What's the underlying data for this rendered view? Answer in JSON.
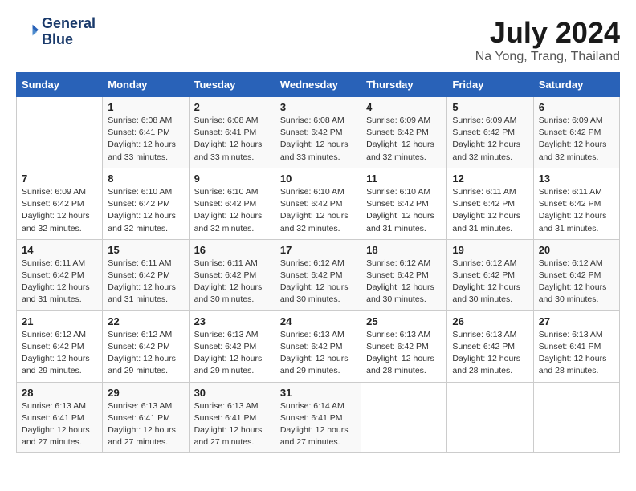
{
  "header": {
    "logo_line1": "General",
    "logo_line2": "Blue",
    "title": "July 2024",
    "subtitle": "Na Yong, Trang, Thailand"
  },
  "calendar": {
    "days_of_week": [
      "Sunday",
      "Monday",
      "Tuesday",
      "Wednesday",
      "Thursday",
      "Friday",
      "Saturday"
    ],
    "weeks": [
      [
        {
          "day": "",
          "sunrise": "",
          "sunset": "",
          "daylight": ""
        },
        {
          "day": "1",
          "sunrise": "6:08 AM",
          "sunset": "6:41 PM",
          "daylight": "12 hours and 33 minutes."
        },
        {
          "day": "2",
          "sunrise": "6:08 AM",
          "sunset": "6:41 PM",
          "daylight": "12 hours and 33 minutes."
        },
        {
          "day": "3",
          "sunrise": "6:08 AM",
          "sunset": "6:42 PM",
          "daylight": "12 hours and 33 minutes."
        },
        {
          "day": "4",
          "sunrise": "6:09 AM",
          "sunset": "6:42 PM",
          "daylight": "12 hours and 32 minutes."
        },
        {
          "day": "5",
          "sunrise": "6:09 AM",
          "sunset": "6:42 PM",
          "daylight": "12 hours and 32 minutes."
        },
        {
          "day": "6",
          "sunrise": "6:09 AM",
          "sunset": "6:42 PM",
          "daylight": "12 hours and 32 minutes."
        }
      ],
      [
        {
          "day": "7",
          "sunrise": "6:09 AM",
          "sunset": "6:42 PM",
          "daylight": "12 hours and 32 minutes."
        },
        {
          "day": "8",
          "sunrise": "6:10 AM",
          "sunset": "6:42 PM",
          "daylight": "12 hours and 32 minutes."
        },
        {
          "day": "9",
          "sunrise": "6:10 AM",
          "sunset": "6:42 PM",
          "daylight": "12 hours and 32 minutes."
        },
        {
          "day": "10",
          "sunrise": "6:10 AM",
          "sunset": "6:42 PM",
          "daylight": "12 hours and 32 minutes."
        },
        {
          "day": "11",
          "sunrise": "6:10 AM",
          "sunset": "6:42 PM",
          "daylight": "12 hours and 31 minutes."
        },
        {
          "day": "12",
          "sunrise": "6:11 AM",
          "sunset": "6:42 PM",
          "daylight": "12 hours and 31 minutes."
        },
        {
          "day": "13",
          "sunrise": "6:11 AM",
          "sunset": "6:42 PM",
          "daylight": "12 hours and 31 minutes."
        }
      ],
      [
        {
          "day": "14",
          "sunrise": "6:11 AM",
          "sunset": "6:42 PM",
          "daylight": "12 hours and 31 minutes."
        },
        {
          "day": "15",
          "sunrise": "6:11 AM",
          "sunset": "6:42 PM",
          "daylight": "12 hours and 31 minutes."
        },
        {
          "day": "16",
          "sunrise": "6:11 AM",
          "sunset": "6:42 PM",
          "daylight": "12 hours and 30 minutes."
        },
        {
          "day": "17",
          "sunrise": "6:12 AM",
          "sunset": "6:42 PM",
          "daylight": "12 hours and 30 minutes."
        },
        {
          "day": "18",
          "sunrise": "6:12 AM",
          "sunset": "6:42 PM",
          "daylight": "12 hours and 30 minutes."
        },
        {
          "day": "19",
          "sunrise": "6:12 AM",
          "sunset": "6:42 PM",
          "daylight": "12 hours and 30 minutes."
        },
        {
          "day": "20",
          "sunrise": "6:12 AM",
          "sunset": "6:42 PM",
          "daylight": "12 hours and 30 minutes."
        }
      ],
      [
        {
          "day": "21",
          "sunrise": "6:12 AM",
          "sunset": "6:42 PM",
          "daylight": "12 hours and 29 minutes."
        },
        {
          "day": "22",
          "sunrise": "6:12 AM",
          "sunset": "6:42 PM",
          "daylight": "12 hours and 29 minutes."
        },
        {
          "day": "23",
          "sunrise": "6:13 AM",
          "sunset": "6:42 PM",
          "daylight": "12 hours and 29 minutes."
        },
        {
          "day": "24",
          "sunrise": "6:13 AM",
          "sunset": "6:42 PM",
          "daylight": "12 hours and 29 minutes."
        },
        {
          "day": "25",
          "sunrise": "6:13 AM",
          "sunset": "6:42 PM",
          "daylight": "12 hours and 28 minutes."
        },
        {
          "day": "26",
          "sunrise": "6:13 AM",
          "sunset": "6:42 PM",
          "daylight": "12 hours and 28 minutes."
        },
        {
          "day": "27",
          "sunrise": "6:13 AM",
          "sunset": "6:41 PM",
          "daylight": "12 hours and 28 minutes."
        }
      ],
      [
        {
          "day": "28",
          "sunrise": "6:13 AM",
          "sunset": "6:41 PM",
          "daylight": "12 hours and 27 minutes."
        },
        {
          "day": "29",
          "sunrise": "6:13 AM",
          "sunset": "6:41 PM",
          "daylight": "12 hours and 27 minutes."
        },
        {
          "day": "30",
          "sunrise": "6:13 AM",
          "sunset": "6:41 PM",
          "daylight": "12 hours and 27 minutes."
        },
        {
          "day": "31",
          "sunrise": "6:14 AM",
          "sunset": "6:41 PM",
          "daylight": "12 hours and 27 minutes."
        },
        {
          "day": "",
          "sunrise": "",
          "sunset": "",
          "daylight": ""
        },
        {
          "day": "",
          "sunrise": "",
          "sunset": "",
          "daylight": ""
        },
        {
          "day": "",
          "sunrise": "",
          "sunset": "",
          "daylight": ""
        }
      ]
    ]
  }
}
